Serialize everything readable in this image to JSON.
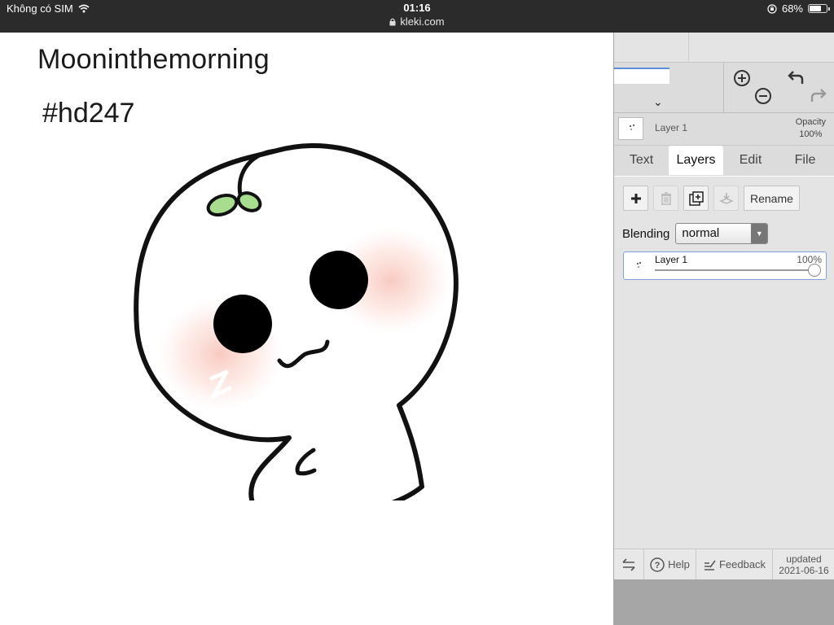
{
  "status_bar": {
    "carrier": "Không có SIM",
    "time": "01:16",
    "url": "kleki.com",
    "battery": "68%",
    "battery_level": 0.68
  },
  "canvas": {
    "title": "Mooninthemorning",
    "tag": "#hd247"
  },
  "toolbar": {
    "icons": [
      "zoom-in-icon",
      "zoom-out-icon",
      "undo-icon",
      "redo-icon"
    ]
  },
  "layer_preview": {
    "name": "Layer 1",
    "opacity_label": "Opacity",
    "opacity_value": "100%"
  },
  "tabs": [
    {
      "label": "Text"
    },
    {
      "label": "Layers",
      "active": true
    },
    {
      "label": "Edit"
    },
    {
      "label": "File"
    }
  ],
  "layers": {
    "rename_label": "Rename",
    "blending_label": "Blending",
    "blending_value": "normal",
    "items": [
      {
        "name": "Layer 1",
        "opacity": "100%",
        "opacity_level": 1.0
      }
    ]
  },
  "footer": {
    "help_label": "Help",
    "feedback_label": "Feedback",
    "updated_label": "updated",
    "updated_date": "2021-06-16"
  },
  "colors": {
    "status_bar": "#2b2b2b",
    "panel": "#dcdcdc",
    "accent": "#5a8fd6"
  }
}
